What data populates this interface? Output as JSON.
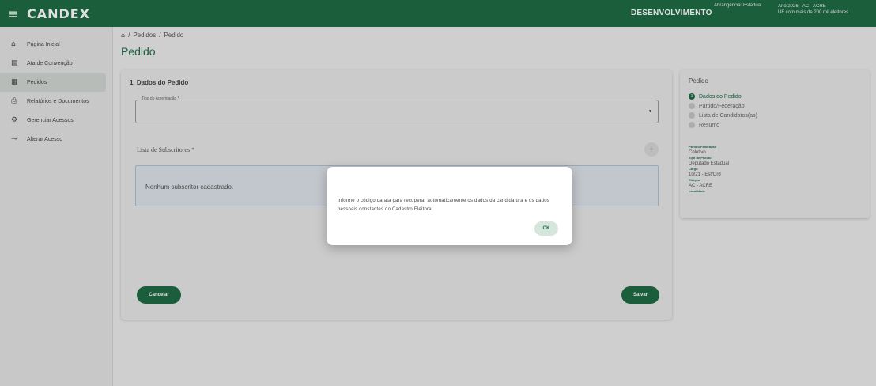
{
  "topbar": {
    "menu_icon": "hamburger-icon",
    "menu_glyph": "≡",
    "logo": "CANDEX",
    "environment": "DESENVOLVIMENTO",
    "scope": "Abrangência: Estadual",
    "year": "Ano 2026 - AC - ACRE",
    "uf_note": "UF com mais de 200 mil eleitores"
  },
  "sidebar": {
    "items": [
      {
        "label": "Página Inicial",
        "icon": "home-icon",
        "glyph": "⌂",
        "active": false
      },
      {
        "label": "Ata de Convenção",
        "icon": "document-icon",
        "glyph": "▤",
        "active": false
      },
      {
        "label": "Pedidos",
        "icon": "orders-icon",
        "glyph": "▦",
        "active": true
      },
      {
        "label": "Relatórios e Documentos",
        "icon": "print-icon",
        "glyph": "⎙",
        "active": false
      },
      {
        "label": "Gerenciar Acessos",
        "icon": "manage-users-icon",
        "glyph": "⚙",
        "active": false
      },
      {
        "label": "Alterar Acesso",
        "icon": "key-icon",
        "glyph": "⊸",
        "active": false
      }
    ]
  },
  "breadcrumb": {
    "home_icon": "home-icon",
    "home_glyph": "⌂",
    "sep1": "/",
    "item1": "Pedidos",
    "sep2": "/",
    "item2": "Pedido"
  },
  "page_title": "Pedido",
  "form": {
    "section_title": "1. Dados do Pedido",
    "agregacao_label": "Tipo de Agremiação *",
    "agregacao_value": "",
    "dropdown_glyph": "▾",
    "subscritores_title": "Lista de Subscritores *",
    "add_glyph": "+",
    "empty_text": "Nenhum subscritor cadastrado.",
    "cancel_label": "Cancelar",
    "save_label": "Salvar"
  },
  "side_panel": {
    "title": "Pedido",
    "steps": [
      {
        "label": "Dados do Pedido",
        "active": true,
        "marker": "1"
      },
      {
        "label": "Partido/Federação",
        "active": false,
        "marker": ""
      },
      {
        "label": "Lista de Candidatos(as)",
        "active": false,
        "marker": ""
      },
      {
        "label": "Resumo",
        "active": false,
        "marker": ""
      }
    ],
    "summary": [
      {
        "label": "Partido/Federação",
        "value": "Coletivo",
        "sub": "Tipo de Pedido"
      },
      {
        "label": "",
        "value": "Deputado Estadual",
        "sub": "Cargo"
      },
      {
        "label": "",
        "value": "10/21 - Est/Ord",
        "sub": "Eleição"
      },
      {
        "label": "",
        "value": "AC - ACRE",
        "sub": "Localidade"
      }
    ]
  },
  "dialog": {
    "message": "Informe o código da ata para recuperar automaticamente os dados da candidatura e os dados pessoais constantes do Cadastro Eleitoral.",
    "ok_label": "OK"
  },
  "colors": {
    "primary": "#1e6b45",
    "background": "#ececec"
  }
}
